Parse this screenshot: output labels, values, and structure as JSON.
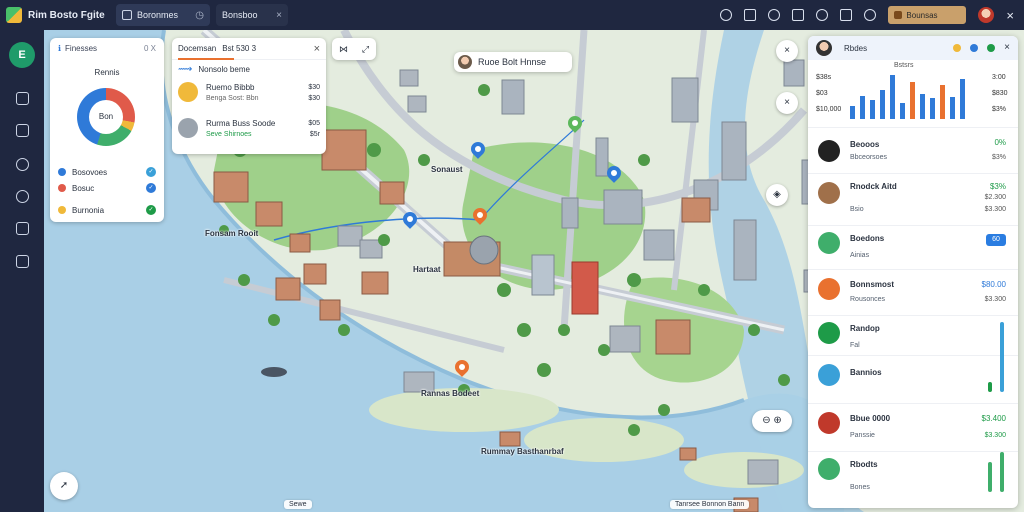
{
  "window": {
    "app_title": "Rim Bosto Fgite",
    "tabs": [
      {
        "label": "Boronmes",
        "active": true
      },
      {
        "label": "Bonsboo",
        "active": false
      }
    ],
    "location_pill": "Bounsas"
  },
  "nav": {
    "home_letter": "E",
    "items": [
      "layers-icon",
      "list-icon",
      "compass-icon",
      "settings-icon",
      "puzzle-icon",
      "export-icon"
    ]
  },
  "stats_card": {
    "header_left": "Finesses",
    "header_hint": "0 X",
    "title": "Rennis",
    "donut_center": "Bon",
    "legend": [
      {
        "label": "Bosovoes",
        "color": "#2f7ad8",
        "badge_color": "#3aa0d8"
      },
      {
        "label": "Bosuc",
        "color": "#e05a4a",
        "badge_color": "#2f7ad8"
      },
      {
        "label": "Burnonia",
        "color": "#f0b93a",
        "badge_color": "#1e9b48"
      }
    ]
  },
  "search_card": {
    "header": "Docemsan",
    "header_extra": "Bst 530 3",
    "route_label": "Nonsolo beme",
    "results": [
      {
        "title": "Ruemo Bibbb",
        "subtitle": "Benga Sost: Bbn",
        "right_top": "$30",
        "right_bottom": "$30",
        "avatar": "#f0b93a"
      },
      {
        "title": "Rurma Buss Soode",
        "subtitle": "Seve Shirnoes",
        "right_top": "$05",
        "right_bottom": "$5r",
        "avatar": "#9aa3ad"
      }
    ]
  },
  "map_labels": {
    "callout": "Ruoe Bolt Hnnse",
    "west_district": "Fonsam Rooit",
    "center": "Hartaat",
    "north_station": "Sonaust",
    "riverside": "Rannas Bodeet",
    "harbor": "Rummay Basthanrbaf",
    "bottom_left": "Sewe",
    "bottom_right": "Tanrsee Bonnon Bann"
  },
  "right_panel": {
    "header": "Rbdes",
    "chart": {
      "type": "bar",
      "title": "Bstsrs",
      "y_labels": [
        "$38s",
        "$03",
        "$10,000"
      ],
      "x_labels": [
        "3:00",
        "$830",
        "$3%"
      ],
      "values": [
        18,
        32,
        26,
        40,
        60,
        22,
        50,
        34,
        28,
        46,
        30,
        54
      ],
      "colors": [
        "#2f7ad8",
        "#2f7ad8",
        "#2f7ad8",
        "#2f7ad8",
        "#2f7ad8",
        "#2f7ad8",
        "#e9712f",
        "#2f7ad8",
        "#2f7ad8",
        "#e9712f",
        "#2f7ad8",
        "#2f7ad8"
      ]
    },
    "rows": [
      {
        "name": "Beooos",
        "sub": "Bbceorsoes",
        "val": "0%",
        "val2": "$3%",
        "avatar": "#222"
      },
      {
        "name": "Rnodck Aitd",
        "sub": "Bsio",
        "val": "$3%",
        "val2": "$2.300",
        "val3": "$3.300",
        "avatar": "#a0704a"
      },
      {
        "name": "Boedons",
        "sub": "Ainias",
        "badge": "60",
        "avatar": "#3fae6b"
      },
      {
        "name": "Bonnsmost",
        "sub": "Rousonces",
        "val": "$80.00",
        "val2": "$3.300",
        "avatar": "#e9712f"
      },
      {
        "name": "Randop",
        "sub": "Fal",
        "avatar": "#1e9b48"
      },
      {
        "name": "Bannios",
        "sub": "",
        "avatar": "#3aa0d8"
      },
      {
        "name": "Bbue 0000",
        "sub": "Panssie",
        "val": "$3.400",
        "val2": "$3.300",
        "avatar": "#c0392b"
      },
      {
        "name": "Rbodts",
        "sub": "Bones",
        "avatar": "#3fae6b"
      }
    ]
  }
}
